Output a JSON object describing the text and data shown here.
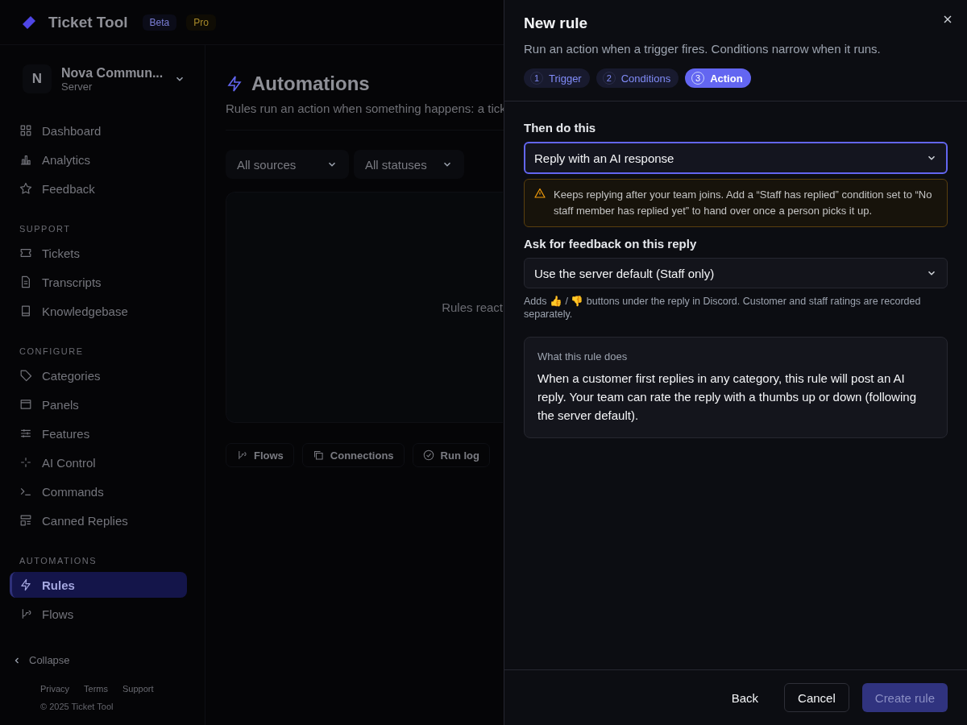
{
  "app": {
    "logo": "Ticket Tool",
    "badges": [
      {
        "label": "Beta",
        "kind": "beta"
      },
      {
        "label": "Pro",
        "kind": "pro"
      }
    ]
  },
  "server": {
    "initial": "N",
    "name": "Nova Commun...",
    "type": "Server"
  },
  "sidebar": {
    "sections": [
      {
        "items": [
          {
            "label": "Dashboard",
            "selected": false
          },
          {
            "label": "Analytics",
            "selected": false
          },
          {
            "label": "Feedback",
            "selected": false
          }
        ]
      },
      {
        "heading": "SUPPORT",
        "items": [
          {
            "label": "Tickets",
            "selected": false
          },
          {
            "label": "Transcripts",
            "selected": false
          },
          {
            "label": "Knowledgebase",
            "selected": false
          }
        ]
      },
      {
        "heading": "CONFIGURE",
        "items": [
          {
            "label": "Categories",
            "selected": false
          },
          {
            "label": "Panels",
            "selected": false
          },
          {
            "label": "Features",
            "selected": false
          },
          {
            "label": "AI Control",
            "selected": false
          },
          {
            "label": "Commands",
            "selected": false
          },
          {
            "label": "Canned Replies",
            "selected": false
          }
        ]
      },
      {
        "heading": "AUTOMATIONS",
        "items": [
          {
            "label": "Rules",
            "selected": true
          },
          {
            "label": "Flows",
            "selected": false
          }
        ]
      }
    ]
  },
  "collapse": "Collapse",
  "footer_links": [
    "Privacy",
    "Terms",
    "Support"
  ],
  "copyright": "© 2025 Ticket Tool",
  "page": {
    "title": "Automations",
    "subtitle": "Rules run an action when something happens: a tick",
    "filters": [
      "All sources",
      "All statuses"
    ],
    "empty_text": "Rules react",
    "tabs": [
      {
        "label": "Flows"
      },
      {
        "label": "Connections"
      },
      {
        "label": "Run log"
      }
    ]
  },
  "drawer": {
    "title": "New rule",
    "subtitle": "Run an action when a trigger fires. Conditions narrow when it runs.",
    "steps": [
      {
        "number": "1",
        "label": "Trigger",
        "selected": false
      },
      {
        "number": "2",
        "label": "Conditions",
        "selected": false
      },
      {
        "number": "3",
        "label": "Action",
        "selected": true
      }
    ],
    "action": {
      "label": "Then do this",
      "value": "Reply with an AI response",
      "focused": true
    },
    "warning": "Keeps replying after your team joins. Add a “Staff has replied” condition set to “No staff member has replied yet” to hand over once a person picks it up.",
    "feedback": {
      "label": "Ask for feedback on this reply",
      "value": "Use the server default (Staff only)",
      "focused": false
    },
    "hint": "Adds 👍 / 👎 buttons under the reply in Discord. Customer and staff ratings are recorded separately.",
    "summary": {
      "title": "What this rule does",
      "text": "When a customer first replies in any category, this rule will post an AI reply. Your team can rate the reply with a thumbs up or down (following the server default)."
    },
    "buttons": [
      {
        "label": "Back",
        "kind": "ghost",
        "disabled": false
      },
      {
        "label": "Cancel",
        "kind": "outline",
        "disabled": false
      },
      {
        "label": "Create rule",
        "kind": "primary",
        "disabled": true
      }
    ]
  }
}
